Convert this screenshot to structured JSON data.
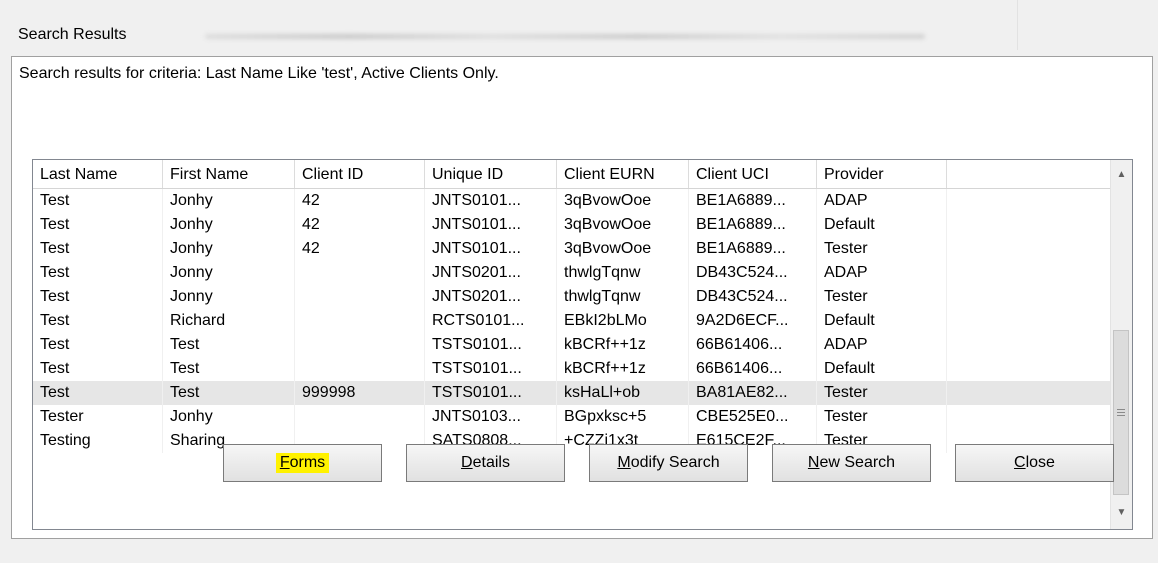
{
  "window": {
    "title": "Search Results"
  },
  "criteria_text": "Search results for criteria:  Last Name Like 'test', Active Clients Only.",
  "table": {
    "columns": [
      "Last Name",
      "First Name",
      "Client ID",
      "Unique ID",
      "Client EURN",
      "Client UCI",
      "Provider",
      ""
    ],
    "rows": [
      [
        "Test",
        "Jonhy",
        "42",
        "JNTS0101...",
        "3qBvowOoe",
        "BE1A6889...",
        "ADAP"
      ],
      [
        "Test",
        "Jonhy",
        "42",
        "JNTS0101...",
        "3qBvowOoe",
        "BE1A6889...",
        "Default"
      ],
      [
        "Test",
        "Jonhy",
        "42",
        "JNTS0101...",
        "3qBvowOoe",
        "BE1A6889...",
        "Tester"
      ],
      [
        "Test",
        "Jonny",
        "",
        "JNTS0201...",
        "thwlgTqnw",
        "DB43C524...",
        "ADAP"
      ],
      [
        "Test",
        "Jonny",
        "",
        "JNTS0201...",
        "thwlgTqnw",
        "DB43C524...",
        "Tester"
      ],
      [
        "Test",
        "Richard",
        "",
        "RCTS0101...",
        "EBkI2bLMo",
        "9A2D6ECF...",
        "Default"
      ],
      [
        "Test",
        "Test",
        "",
        "TSTS0101...",
        "kBCRf++1z",
        "66B61406...",
        "ADAP"
      ],
      [
        "Test",
        "Test",
        "",
        "TSTS0101...",
        "kBCRf++1z",
        "66B61406...",
        "Default"
      ],
      [
        "Test",
        "Test",
        "999998",
        "TSTS0101...",
        "ksHaLl+ob",
        "BA81AE82...",
        "Tester"
      ],
      [
        "Tester",
        "Jonhy",
        "",
        "JNTS0103...",
        "BGpxksc+5",
        "CBE525E0...",
        "Tester"
      ],
      [
        "Testing",
        "Sharing",
        "",
        "SATS0808...",
        "+CZZi1x3t",
        "E615CE2F...",
        "Tester"
      ]
    ],
    "selected_row_index": 8
  },
  "buttons": {
    "forms": {
      "first": "F",
      "rest": "orms"
    },
    "details": {
      "first": "D",
      "rest": "etails"
    },
    "modify_search": {
      "first": "M",
      "rest": "odify Search"
    },
    "new_search": {
      "first": "N",
      "rest": "ew Search"
    },
    "close": {
      "first": "C",
      "rest": "lose"
    }
  },
  "icons": {
    "scroll_up": "triangle-up-icon",
    "scroll_down": "triangle-down-icon",
    "scroll_grip": "grip-icon"
  },
  "colors": {
    "highlight": "#fff200",
    "selected_row": "#e6e6e6"
  }
}
